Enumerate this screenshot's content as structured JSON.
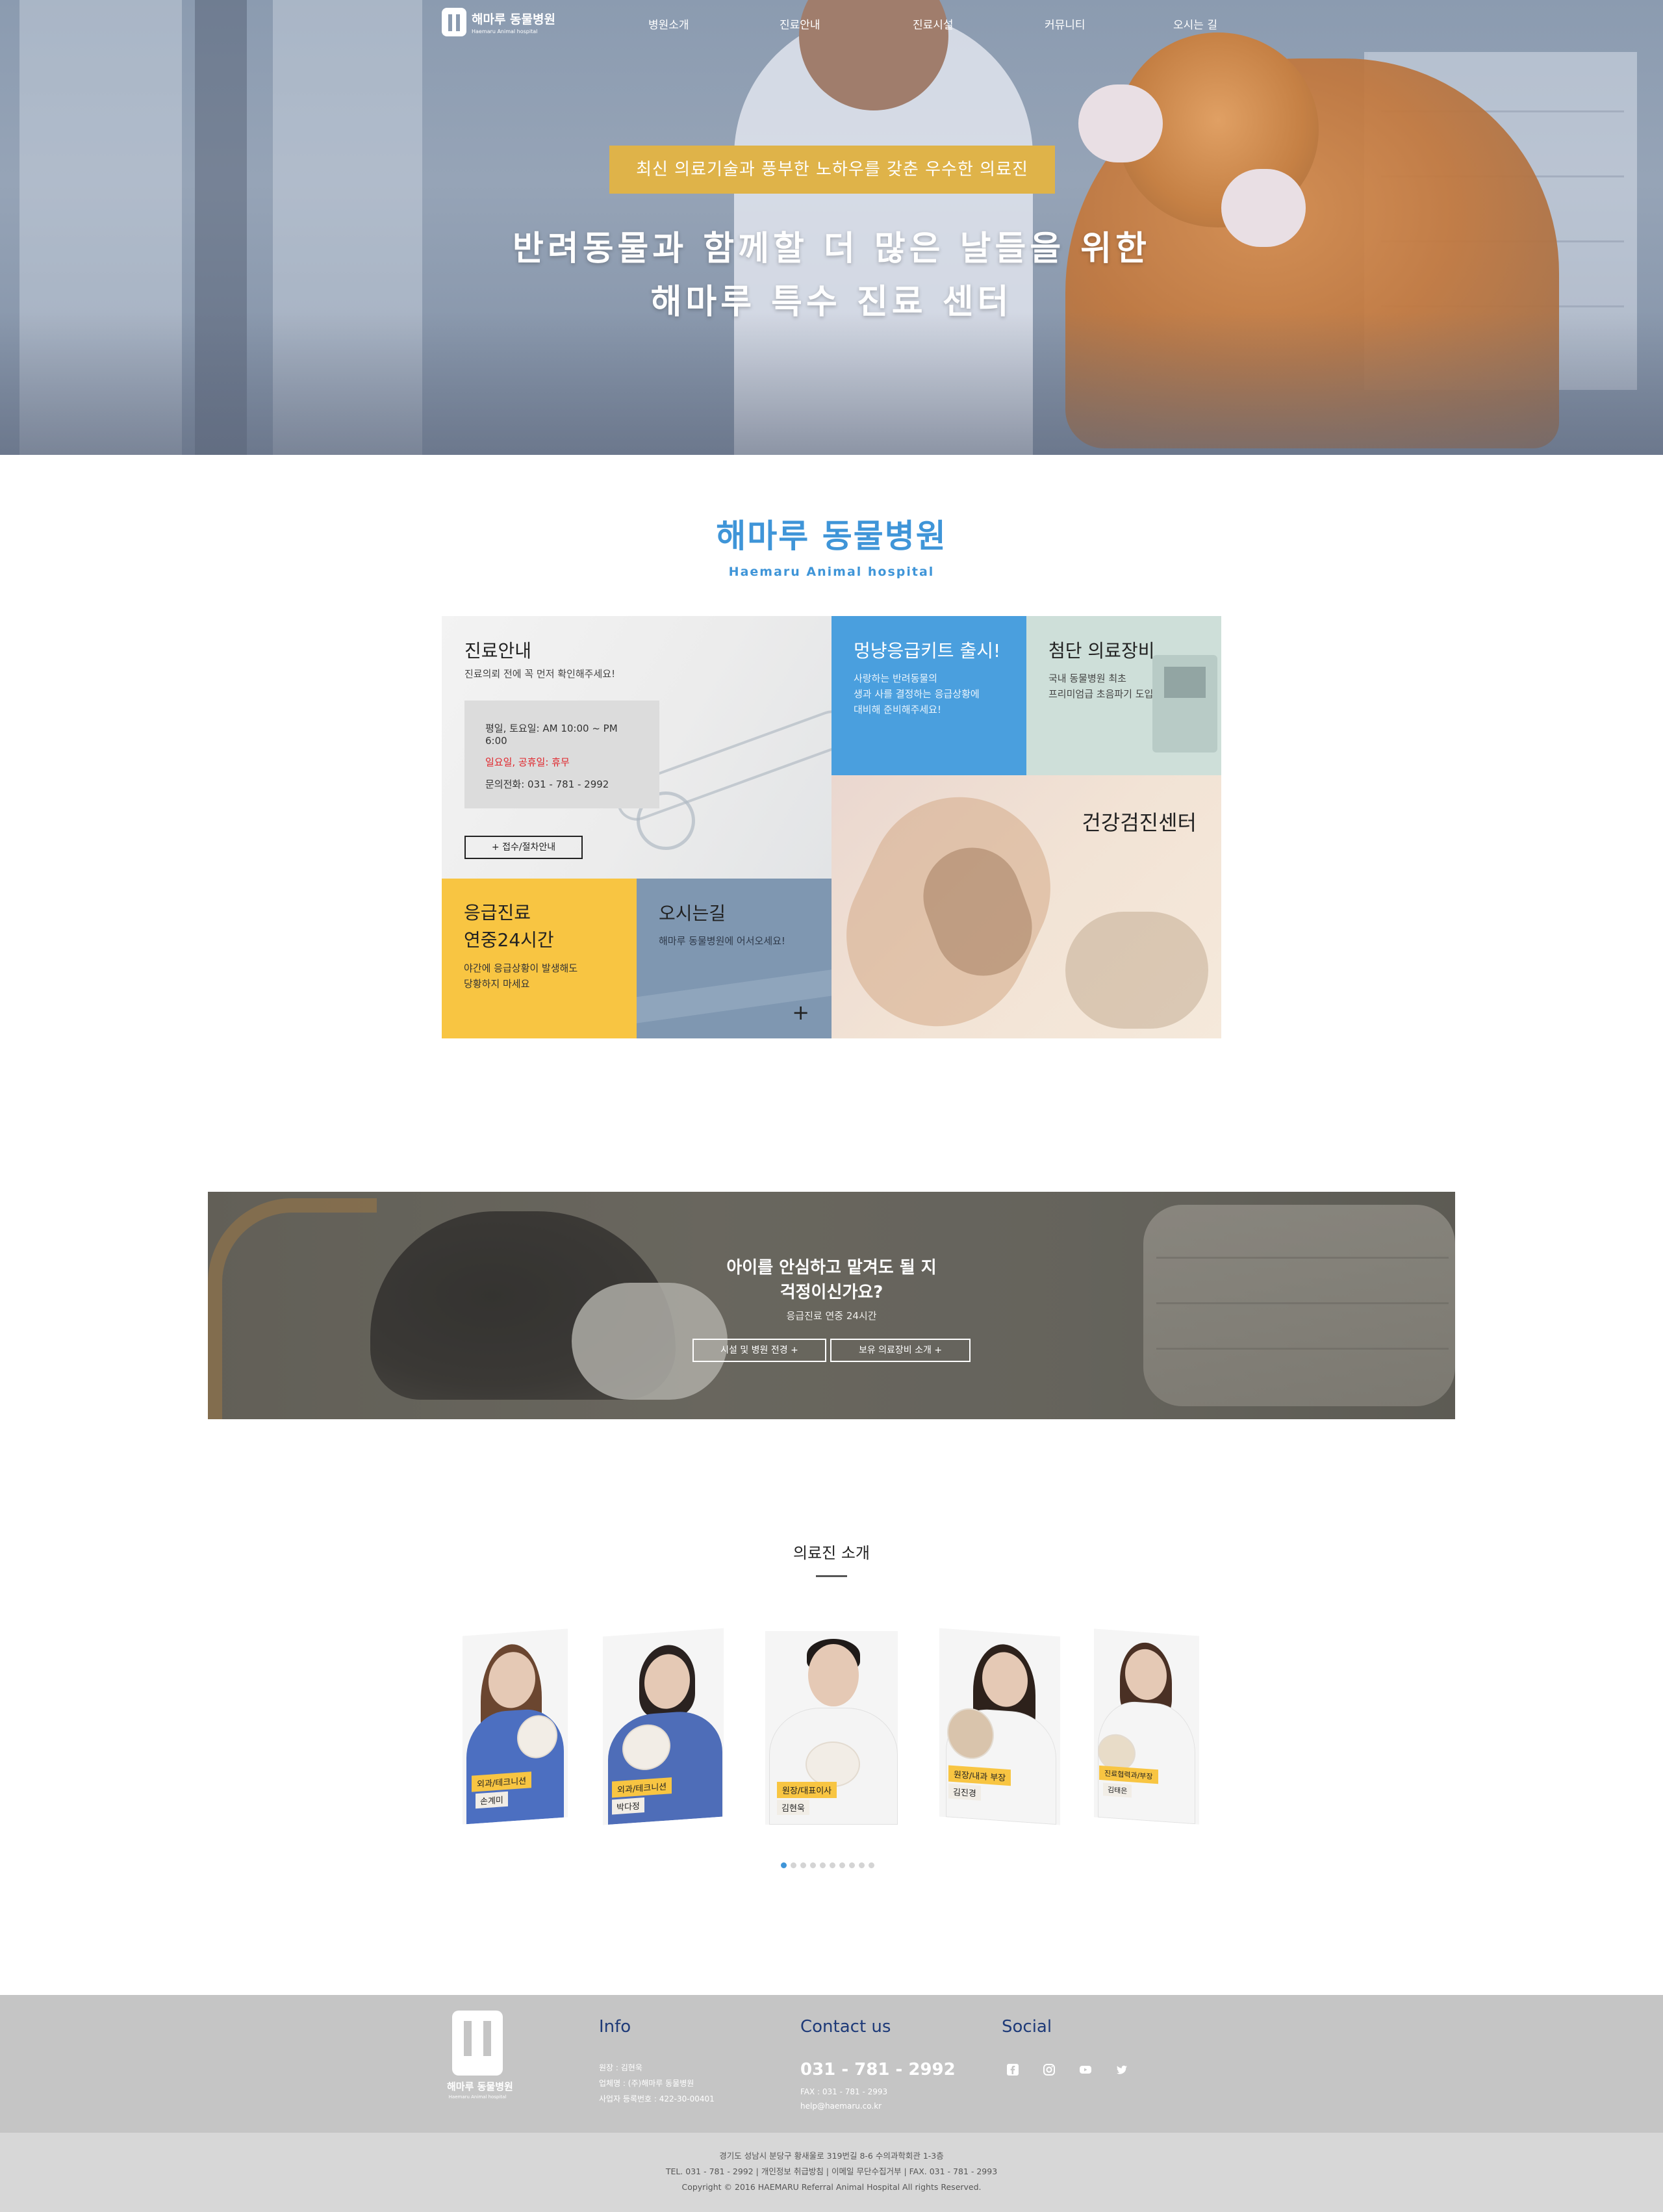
{
  "nav": {
    "logo_ko": "해마루 동물병원",
    "logo_en": "Haemaru Animal hospital",
    "items": [
      "병원소개",
      "진료안내",
      "진료시설",
      "커뮤니티",
      "오시는 길"
    ]
  },
  "hero": {
    "badge": "최신 의료기술과 풍부한 노하우를 갖춘 우수한 의료진",
    "title_line1": "반려동물과 함께할 더 많은 날들을 위한",
    "title_line2": "해마루 특수 진료 센터"
  },
  "brand": {
    "name_ko": "해마루 동물병원",
    "name_en": "Haemaru Animal hospital"
  },
  "grid": {
    "guide": {
      "title": "진료안내",
      "subtitle": "진료의뢰 전에 꼭 먼저 확인해주세요!",
      "weekday": "평일, 토요일: AM 10:00 ~ PM 6:00",
      "holiday": "일요일, 공휴일: 휴무",
      "phone": "문의전화: 031 - 781 - 2992",
      "button": "+ 접수/절차안내"
    },
    "kit": {
      "title": "멍냥응급키트 출시!",
      "line1": "사랑하는 반려동물의",
      "line2": "생과 사를 결정하는 응급상황에",
      "line3": "대비해 준비해주세요!"
    },
    "equipment": {
      "title": "첨단 의료장비",
      "line1": "국내 동물병원 최초",
      "line2": "프리미엄급 초음파기 도입"
    },
    "health": {
      "title": "건강검진센터"
    },
    "emergency": {
      "title_line1": "응급진료",
      "title_line2": "연중24시간",
      "line1": "야간에 응급상황이 발생해도",
      "line2": "당황하지 마세요"
    },
    "location": {
      "title": "오시는길",
      "desc": "해마루 동물병원에 어서오세요!",
      "plus": "+"
    }
  },
  "banner": {
    "line1": "아이를 안심하고 맡겨도 될 지",
    "line2": "걱정이신가요?",
    "sub": "응급진료 연중 24시간",
    "button1": "시설 및 병원 전경 +",
    "button2": "보유 의료장비 소개 +"
  },
  "staff": {
    "title": "의료진 소개",
    "members": [
      {
        "role": "외과/테크니션",
        "name": "손계미"
      },
      {
        "role": "외과/테크니션",
        "name": "박다정"
      },
      {
        "role": "원장/대표이사",
        "name": "김현욱"
      },
      {
        "role": "원장/내과 부장",
        "name": "김진경"
      },
      {
        "role": "진료협력과/부장",
        "name": "김태은"
      }
    ],
    "dots": 10,
    "active_dot": 0
  },
  "footer": {
    "logo_ko": "해마루 동물병원",
    "logo_en": "Haemaru Animal hospital",
    "info_title": "Info",
    "info_lines": [
      "원장 : 김현욱",
      "업체명 : (주)해마루 동물병원",
      "사업자 등록번호 : 422-30-00401"
    ],
    "contact_title": "Contact us",
    "phone": "031 - 781 - 2992",
    "fax": "FAX : 031 - 781 - 2993",
    "email": "help@haemaru.co.kr",
    "social_title": "Social",
    "social_icons": [
      "facebook-icon",
      "instagram-icon",
      "youtube-icon",
      "twitter-icon"
    ],
    "address": "경기도 성남시 분당구 황새울로 319번길 8-6 수의과학회관 1-3층",
    "tel_line": "TEL. 031 - 781 - 2992 | 개인정보 취급방침 | 이메일 무단수집거부 | FAX. 031 - 781 - 2993",
    "copyright": "Copyright © 2016 HAEMARU Referral Animal Hospital All rights Reserved."
  },
  "colors": {
    "brand_blue": "#3f95d8",
    "gold": "#dfb349",
    "yellow": "#f8c542",
    "footer_navy": "#1e3a78"
  }
}
